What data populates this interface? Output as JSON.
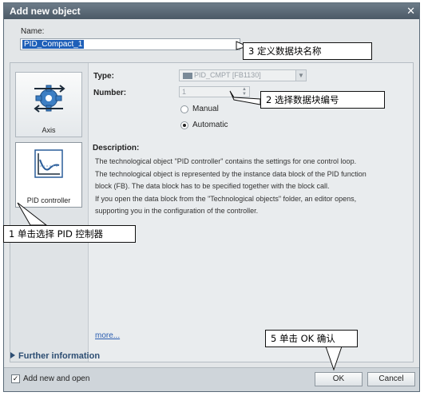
{
  "dialog": {
    "title": "Add new object",
    "close_glyph": "✕",
    "name_label": "Name:",
    "name_value": "PID_Compact_1"
  },
  "tiles": [
    {
      "label": "Axis",
      "icon": "axis-gear-icon",
      "selected": false
    },
    {
      "label": "PID controller",
      "icon": "pid-controller-icon",
      "selected": true
    }
  ],
  "properties": {
    "type_label": "Type:",
    "type_value": "PID_CMPT  [FB1130]",
    "number_label": "Number:",
    "number_value": "1",
    "radio_manual": "Manual",
    "radio_automatic": "Automatic",
    "selected_mode": "Automatic"
  },
  "description": {
    "title": "Description:",
    "lines": [
      "The technological object \"PID controller\" contains the settings for one control loop.",
      "The technological object is represented by the instance data block of the PID function",
      "block (FB). The data block has to be specified together with the block call.",
      "If you open the data block from the \"Technological objects\" folder, an editor opens,",
      "supporting you in the configuration of  the controller."
    ]
  },
  "more_link": "more...",
  "further_info": "Further information",
  "footer": {
    "checkbox_label": "Add new and open",
    "checkbox_checked": true,
    "ok": "OK",
    "cancel": "Cancel"
  },
  "callouts": {
    "c1": "1 单击选择 PID 控制器",
    "c2": "2 选择数据块编号",
    "c3": "3 定义数据块名称",
    "c5": "5 单击 OK 确认"
  }
}
